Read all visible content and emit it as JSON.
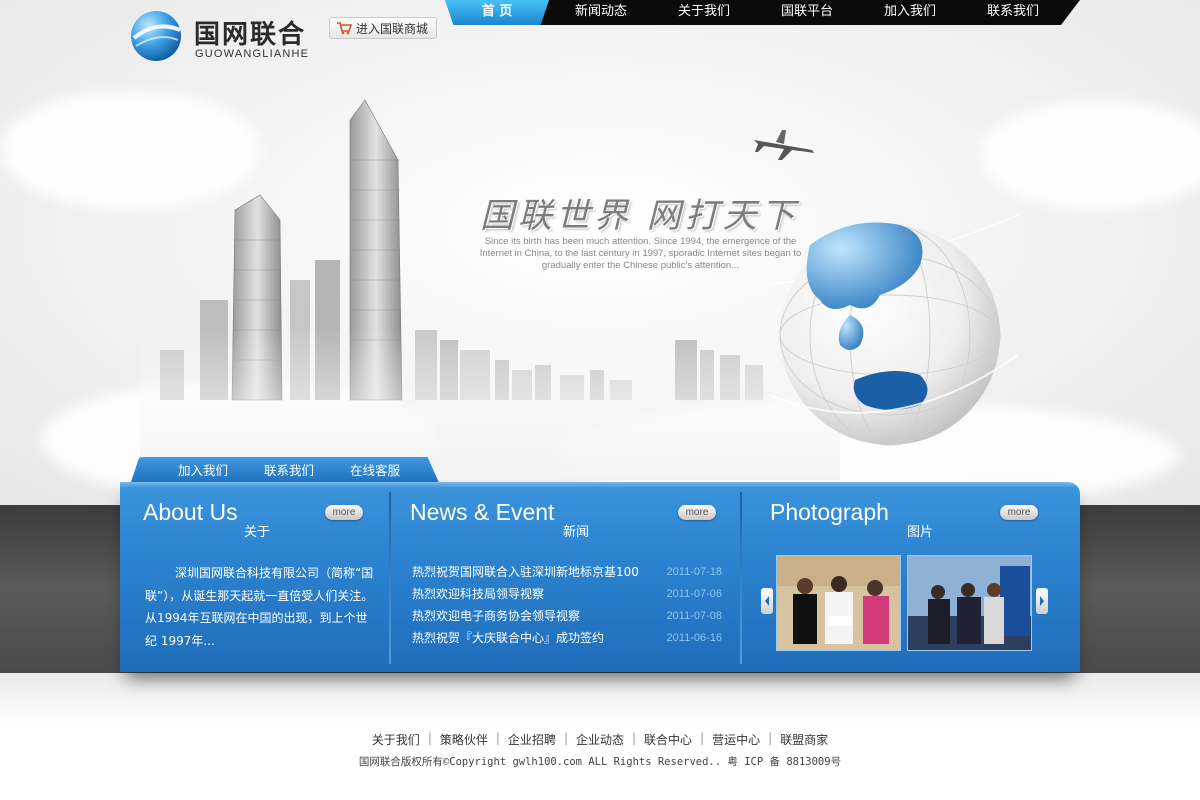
{
  "logo": {
    "name_cn": "国网联合",
    "name_en": "GUOWANGLIANHE"
  },
  "shop_button": {
    "label": "进入国联商城",
    "icon": "cart-icon"
  },
  "nav": {
    "items": [
      {
        "label": "首 页",
        "active": true
      },
      {
        "label": "新闻动态",
        "active": false
      },
      {
        "label": "关于我们",
        "active": false
      },
      {
        "label": "国联平台",
        "active": false
      },
      {
        "label": "加入我们",
        "active": false
      },
      {
        "label": "联系我们",
        "active": false
      }
    ]
  },
  "hero": {
    "slogan": "国联世界 网打天下",
    "subtext": "Since its birth has been much attention. Since 1994, the emergence of the Internet in China, to the last century in 1997, sporadic Internet sites began to gradually enter the Chinese public's attention..."
  },
  "sub_tabs": {
    "items": [
      {
        "label": "加入我们"
      },
      {
        "label": "联系我们"
      },
      {
        "label": "在线客服"
      }
    ]
  },
  "about": {
    "title_en": "About Us",
    "title_cn": "关于",
    "more": "more",
    "text": "深圳国网联合科技有限公司（简称“国联”），从诞生那天起就一直倍受人们关注。从1994年互联网在中国的出现，到上个世纪 1997年..."
  },
  "news": {
    "title_en": "News & Event",
    "title_cn": "新闻",
    "more": "more",
    "items": [
      {
        "title": "热烈祝贺国网联合入驻深圳新地标京基100",
        "date": "2011-07-18"
      },
      {
        "title": "热烈欢迎科技局领导视察",
        "date": "2011-07-06"
      },
      {
        "title": "热烈欢迎电子商务协会领导视察",
        "date": "2011-07-08"
      },
      {
        "title": "热烈祝贺『大庆联合中心』成功签约",
        "date": "2011-06-16"
      }
    ]
  },
  "photo": {
    "title_en": "Photograph",
    "title_cn": "图片",
    "more": "more"
  },
  "footer": {
    "links": [
      {
        "label": "关于我们"
      },
      {
        "label": "策略伙伴"
      },
      {
        "label": "企业招聘"
      },
      {
        "label": "企业动态"
      },
      {
        "label": "联合中心"
      },
      {
        "label": "营运中心"
      },
      {
        "label": "联盟商家"
      }
    ],
    "copyright": "国网联合版权所有©Copyright gwlh100.com ALL Rights Reserved.. 粤 ICP 备 8813009号"
  },
  "colors": {
    "accent_blue": "#2c83cf",
    "nav_active": "#1b86cf",
    "nav_bg": "#0b0b0b",
    "date_color": "#8ec6f3"
  }
}
